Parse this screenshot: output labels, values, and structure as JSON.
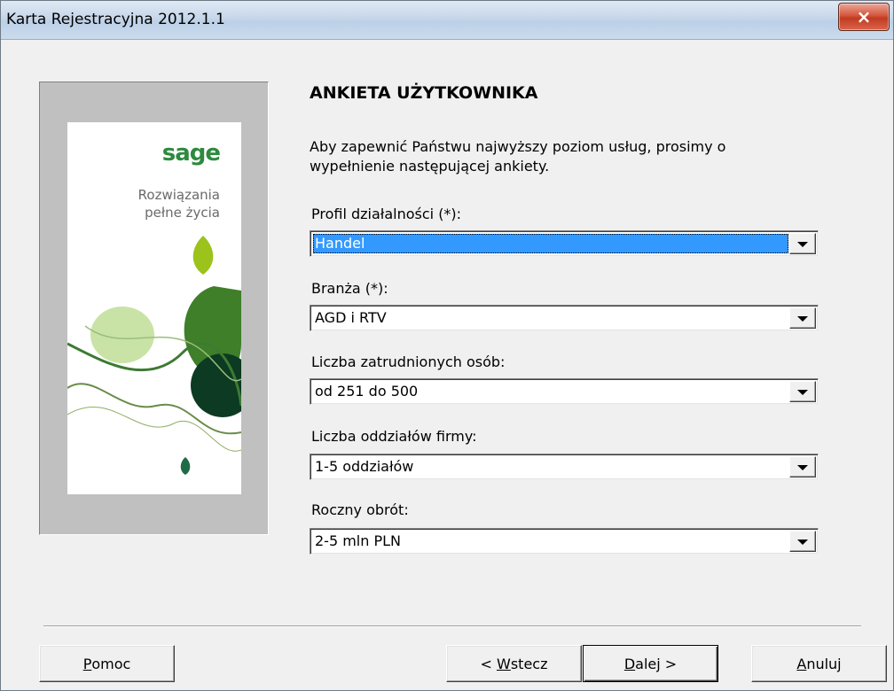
{
  "window": {
    "title": "Karta Rejestracyjna 2012.1.1",
    "close_symbol": "×"
  },
  "promo": {
    "logo": "sage",
    "tagline_line1": "Rozwiązania",
    "tagline_line2": "pełne życia",
    "colors": {
      "brand": "#2d8a3e",
      "lime": "#9bc31c",
      "dark_green": "#0c3a22",
      "light_green": "#c9e3a7"
    }
  },
  "survey": {
    "heading": "ANKIETA UŻYTKOWNIKA",
    "intro_line1": "Aby zapewnić Państwu najwyższy poziom usług, prosimy o",
    "intro_line2": "wypełnienie następującej ankiety.",
    "fields": [
      {
        "label": "Profil działalności (*):",
        "value": "Handel"
      },
      {
        "label": "Branża (*):",
        "value": "AGD i RTV"
      },
      {
        "label": "Liczba zatrudnionych osób:",
        "value": "od 251 do 500"
      },
      {
        "label": "Liczba oddziałów firmy:",
        "value": "1-5 oddziałów"
      },
      {
        "label": "Roczny obrót:",
        "value": "2-5 mln PLN"
      }
    ]
  },
  "buttons": {
    "help_first": "P",
    "help_rest": "omoc",
    "back_prefix": "< ",
    "back_first": "W",
    "back_rest": "stecz",
    "next_first": "D",
    "next_rest": "alej >",
    "cancel_first": "A",
    "cancel_rest": "nuluj"
  },
  "colors": {
    "selection": "#3399ff",
    "dialog_bg": "#f0f0f0",
    "close_button": "#c23b22"
  }
}
